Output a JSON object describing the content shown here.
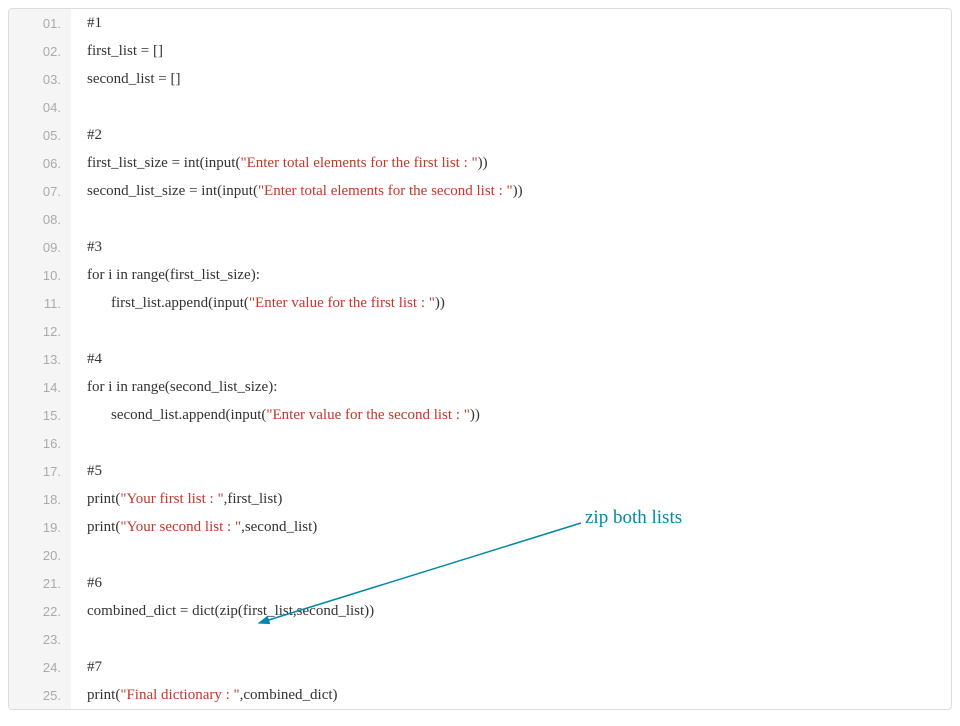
{
  "lines": [
    {
      "num": "01.",
      "segments": [
        {
          "t": "#1",
          "c": "plain"
        }
      ]
    },
    {
      "num": "02.",
      "segments": [
        {
          "t": "first_list = []",
          "c": "plain"
        }
      ]
    },
    {
      "num": "03.",
      "segments": [
        {
          "t": "second_list = []",
          "c": "plain"
        }
      ]
    },
    {
      "num": "04.",
      "segments": []
    },
    {
      "num": "05.",
      "segments": [
        {
          "t": "#2",
          "c": "plain"
        }
      ]
    },
    {
      "num": "06.",
      "segments": [
        {
          "t": "first_list_size = int(input(",
          "c": "plain"
        },
        {
          "t": "\"Enter total elements for the first list : \"",
          "c": "str"
        },
        {
          "t": "))",
          "c": "plain"
        }
      ]
    },
    {
      "num": "07.",
      "segments": [
        {
          "t": "second_list_size = int(input(",
          "c": "plain"
        },
        {
          "t": "\"Enter total elements for the second list : \"",
          "c": "str"
        },
        {
          "t": "))",
          "c": "plain"
        }
      ]
    },
    {
      "num": "08.",
      "segments": []
    },
    {
      "num": "09.",
      "segments": [
        {
          "t": "#3",
          "c": "plain"
        }
      ]
    },
    {
      "num": "10.",
      "segments": [
        {
          "t": "for i in range(first_list_size):",
          "c": "plain"
        }
      ]
    },
    {
      "num": "11.",
      "indent": 1,
      "segments": [
        {
          "t": "first_list.append(input(",
          "c": "plain"
        },
        {
          "t": "\"Enter value for the first list : \"",
          "c": "str"
        },
        {
          "t": "))",
          "c": "plain"
        }
      ]
    },
    {
      "num": "12.",
      "segments": []
    },
    {
      "num": "13.",
      "segments": [
        {
          "t": "#4",
          "c": "plain"
        }
      ]
    },
    {
      "num": "14.",
      "segments": [
        {
          "t": "for i in range(second_list_size):",
          "c": "plain"
        }
      ]
    },
    {
      "num": "15.",
      "indent": 1,
      "segments": [
        {
          "t": "second_list.append(input(",
          "c": "plain"
        },
        {
          "t": "\"Enter value for the second list : \"",
          "c": "str"
        },
        {
          "t": "))",
          "c": "plain"
        }
      ]
    },
    {
      "num": "16.",
      "segments": []
    },
    {
      "num": "17.",
      "segments": [
        {
          "t": "#5",
          "c": "plain"
        }
      ]
    },
    {
      "num": "18.",
      "segments": [
        {
          "t": "print(",
          "c": "plain"
        },
        {
          "t": "\"Your first list : \"",
          "c": "str"
        },
        {
          "t": ",first_list)",
          "c": "plain"
        }
      ]
    },
    {
      "num": "19.",
      "segments": [
        {
          "t": "print(",
          "c": "plain"
        },
        {
          "t": "\"Your second list : \"",
          "c": "str"
        },
        {
          "t": ",second_list)",
          "c": "plain"
        }
      ]
    },
    {
      "num": "20.",
      "segments": []
    },
    {
      "num": "21.",
      "segments": [
        {
          "t": "#6",
          "c": "plain"
        }
      ]
    },
    {
      "num": "22.",
      "segments": [
        {
          "t": "combined_dict = dict(zip(first_list,second_list))",
          "c": "plain"
        }
      ]
    },
    {
      "num": "23.",
      "segments": []
    },
    {
      "num": "24.",
      "segments": [
        {
          "t": "#7",
          "c": "plain"
        }
      ]
    },
    {
      "num": "25.",
      "segments": [
        {
          "t": "print(",
          "c": "plain"
        },
        {
          "t": "\"Final dictionary : \"",
          "c": "str"
        },
        {
          "t": ",combined_dict)",
          "c": "plain"
        }
      ]
    }
  ],
  "annotation_text": "zip both lists"
}
